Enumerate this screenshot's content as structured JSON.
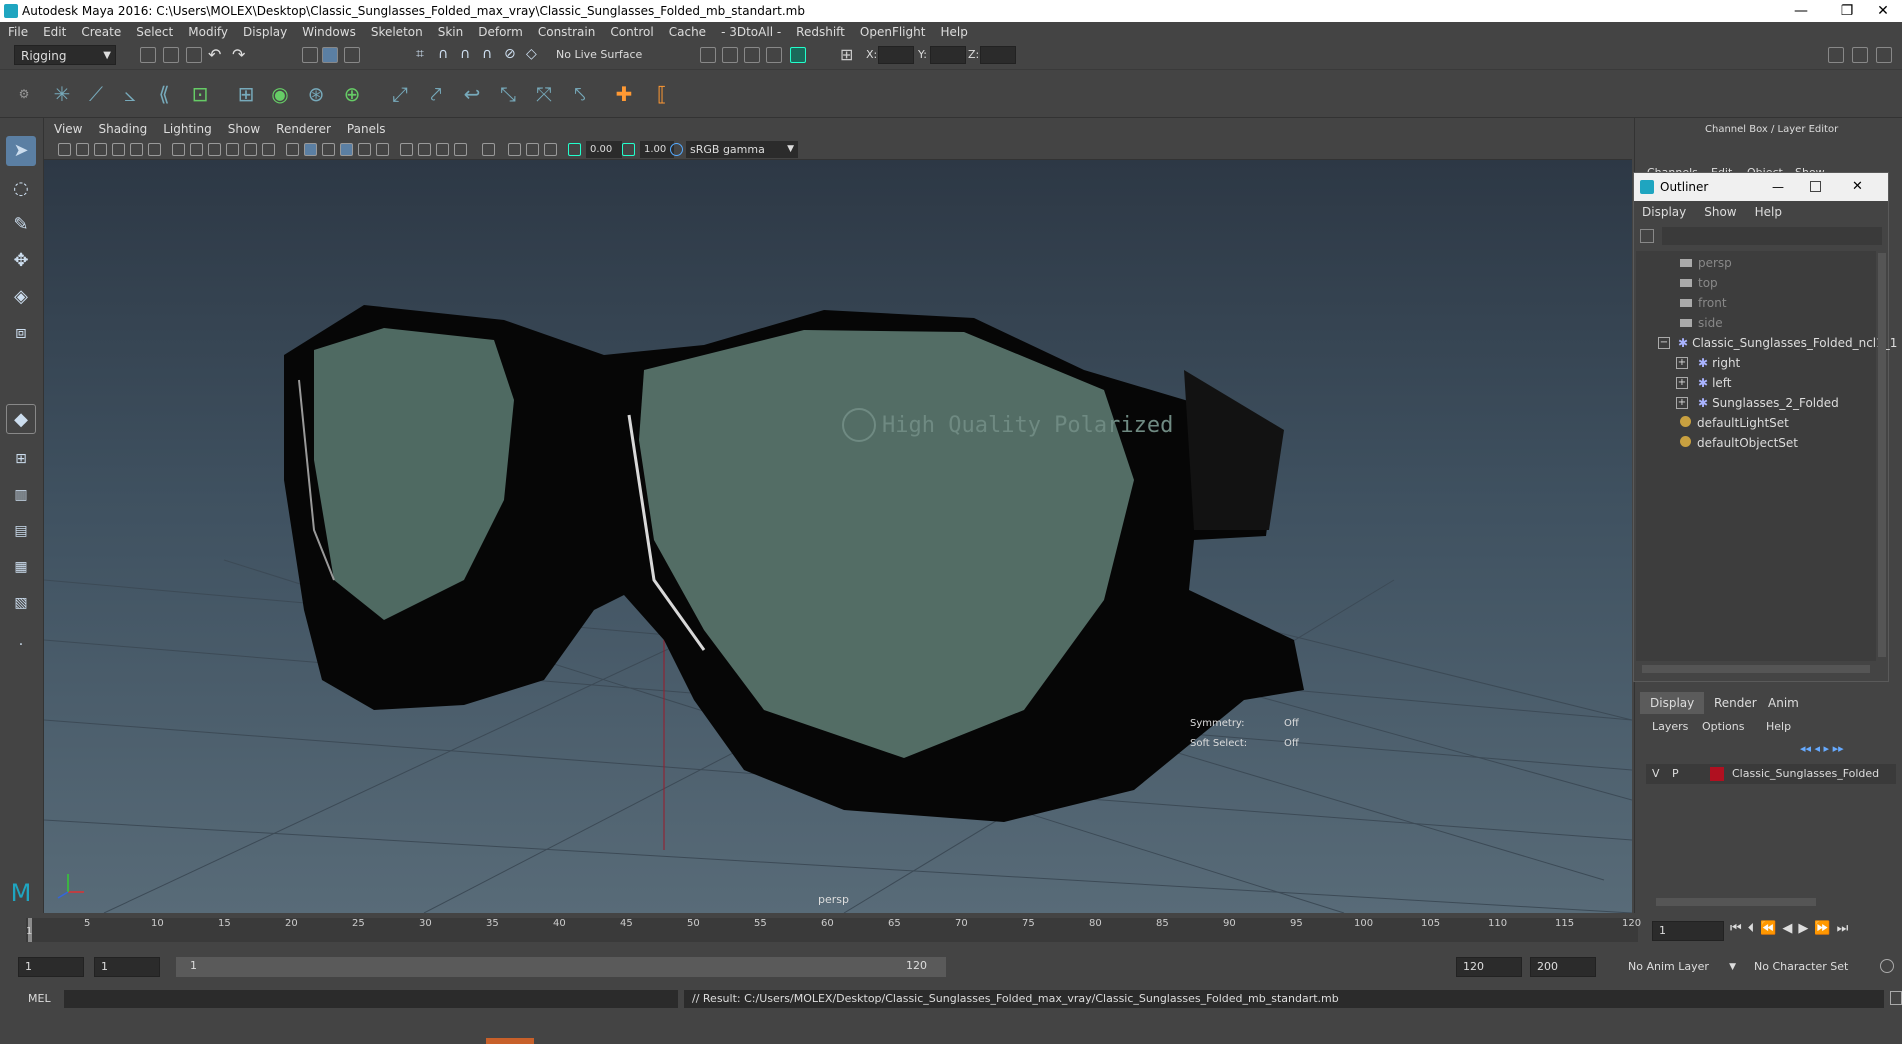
{
  "window": {
    "title": "Autodesk Maya 2016: C:\\Users\\MOLEX\\Desktop\\Classic_Sunglasses_Folded_max_vray\\Classic_Sunglasses_Folded_mb_standart.mb",
    "min": "—",
    "restore": "❐",
    "close": "✕"
  },
  "menubar": [
    "File",
    "Edit",
    "Create",
    "Select",
    "Modify",
    "Display",
    "Windows",
    "Skeleton",
    "Skin",
    "Deform",
    "Constrain",
    "Control",
    "Cache",
    "- 3DtoAll -",
    "Redshift",
    "OpenFlight",
    "Help"
  ],
  "statusline": {
    "menuset": "Rigging",
    "live_surface": "No Live Surface",
    "x_label": "X:",
    "y_label": "Y:",
    "z_label": "Z:"
  },
  "panel": {
    "menus": [
      "View",
      "Shading",
      "Lighting",
      "Show",
      "Renderer",
      "Panels"
    ],
    "exposure": "0.00",
    "gamma": "1.00",
    "colorspace": "sRGB gamma"
  },
  "viewport": {
    "camera_label": "persp",
    "lens_text": "High Quality Polarized",
    "hud": [
      {
        "label": "Symmetry:",
        "value": "Off"
      },
      {
        "label": "Soft Select:",
        "value": "Off"
      }
    ]
  },
  "channelbox": {
    "title": "Channel Box / Layer Editor",
    "menus": [
      "Channels",
      "Edit",
      "Object",
      "Show"
    ]
  },
  "outliner": {
    "title": "Outliner",
    "menus": [
      "Display",
      "Show",
      "Help"
    ],
    "items": [
      {
        "label": "persp",
        "dim": true
      },
      {
        "label": "top",
        "dim": true
      },
      {
        "label": "front",
        "dim": true
      },
      {
        "label": "side",
        "dim": true
      },
      {
        "label": "Classic_Sunglasses_Folded_ncl1_1",
        "dim": false
      },
      {
        "label": "right",
        "dim": false
      },
      {
        "label": "left",
        "dim": false
      },
      {
        "label": "Sunglasses_2_Folded",
        "dim": false
      },
      {
        "label": "defaultLightSet",
        "dim": false
      },
      {
        "label": "defaultObjectSet",
        "dim": false
      }
    ]
  },
  "layers": {
    "tabs": [
      "Display",
      "Render",
      "Anim"
    ],
    "menus": [
      "Layers",
      "Options",
      "Help"
    ],
    "layer": {
      "v": "V",
      "p": "P",
      "name": "Classic_Sunglasses_Folded",
      "color": "#b01020"
    }
  },
  "timeslider": {
    "ticks": [
      "5",
      "10",
      "15",
      "20",
      "25",
      "30",
      "35",
      "40",
      "45",
      "50",
      "55",
      "60",
      "65",
      "70",
      "75",
      "80",
      "85",
      "90",
      "95",
      "100",
      "105",
      "110",
      "115",
      "120"
    ],
    "start_tick": "1",
    "current_frame": "1"
  },
  "rangeslider": {
    "start": "1",
    "playback_start": "1",
    "range_start_label": "1",
    "range_end_label": "120",
    "playback_end": "120",
    "end": "200",
    "anim_layer": "No Anim Layer",
    "char_set": "No Character Set"
  },
  "cmdline": {
    "mode": "MEL",
    "result": "// Result: C:/Users/MOLEX/Desktop/Classic_Sunglasses_Folded_max_vray/Classic_Sunglasses_Folded_mb_standart.mb"
  },
  "colors": {
    "accent": "#5aa0c8",
    "maya_logo": "#1fa5c0",
    "active_tool": "#5b7fa3"
  }
}
